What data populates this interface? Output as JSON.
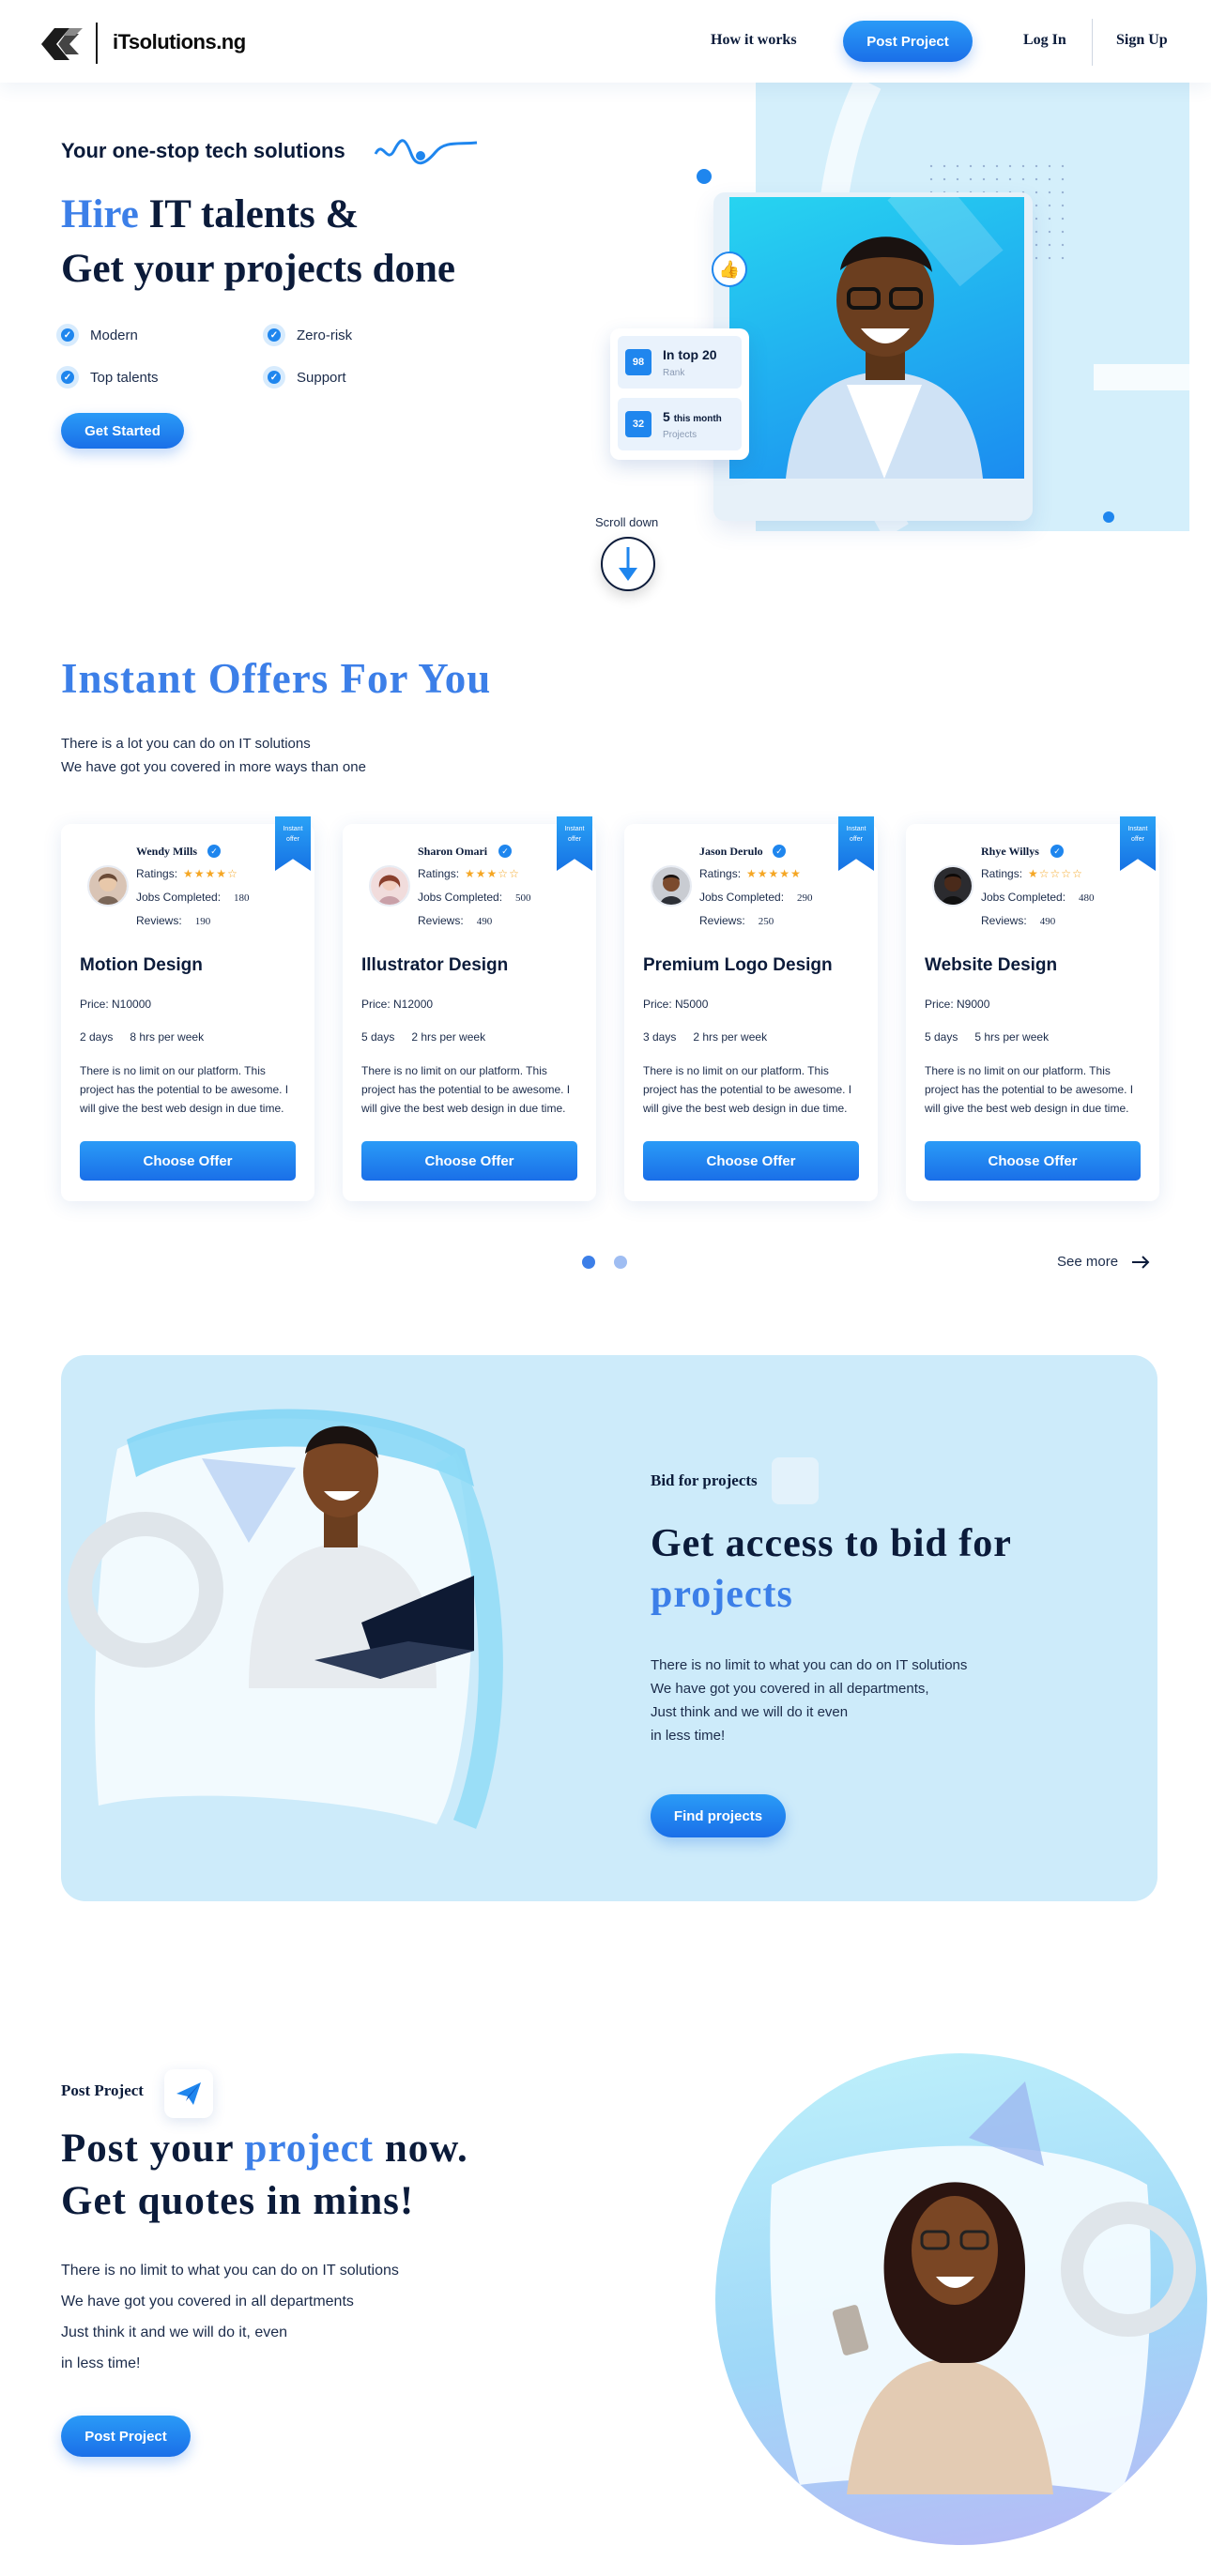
{
  "header": {
    "logo_text": "iTsolutions.ng",
    "nav": {
      "how_it_works": "How it works",
      "post_project": "Post Project",
      "login": "Log In",
      "signup": "Sign Up"
    }
  },
  "hero": {
    "tagline": "Your one-stop tech solutions",
    "title_accent": "Hire",
    "title_rest": " IT talents &",
    "title_line2": "Get your projects done",
    "features": [
      "Modern",
      "Zero-risk",
      "Top talents",
      "Support"
    ],
    "cta": "Get Started",
    "stat1": {
      "num": "98",
      "title": "In top 20",
      "sub": "Rank"
    },
    "stat2": {
      "num": "32",
      "title": "5",
      "title_small": "this month",
      "sub": "Projects"
    },
    "scroll": "Scroll down"
  },
  "offers": {
    "title": "Instant Offers For You",
    "sub1": "There is a lot you can do on IT solutions",
    "sub2": "We have got you covered in more ways than one",
    "ribbon_line1": "Instant",
    "ribbon_line2": "offer",
    "label_ratings": "Ratings:",
    "label_jobs": "Jobs Completed:",
    "label_reviews": "Reviews:",
    "desc": "There is no limit on our platform. This project has the potential to be awesome. I will give the best web design in due time.",
    "button": "Choose Offer",
    "cards": [
      {
        "name": "Wendy Mills",
        "stars": "★★★★☆",
        "jobs": "180",
        "reviews": "190",
        "title": "Motion Design",
        "price": "Price: N10000",
        "days": "2 days",
        "hours": "8 hrs per week"
      },
      {
        "name": "Sharon Omari",
        "stars": "★★★☆☆",
        "jobs": "500",
        "reviews": "490",
        "title": "Illustrator Design",
        "price": "Price: N12000",
        "days": "5 days",
        "hours": "2 hrs per week"
      },
      {
        "name": "Jason Derulo",
        "stars": "★★★★★",
        "jobs": "290",
        "reviews": "250",
        "title": "Premium Logo Design",
        "price": "Price: N5000",
        "days": "3 days",
        "hours": "2 hrs per week"
      },
      {
        "name": "Rhye Willys",
        "stars": "★☆☆☆☆",
        "jobs": "480",
        "reviews": "490",
        "title": "Website Design",
        "price": "Price: N9000",
        "days": "5 days",
        "hours": "5 hrs per week"
      }
    ],
    "see_more": "See more"
  },
  "bid": {
    "eyebrow": "Bid for projects",
    "title_line1": "Get access to bid for",
    "title_accent": "projects",
    "text": [
      "There is no limit to what you can do on IT solutions",
      "We have got you covered in all departments,",
      "Just think and we will do it even",
      "in less time!"
    ],
    "cta": "Find projects"
  },
  "post": {
    "eyebrow": "Post Project",
    "title_a": "Post your ",
    "title_accent": "project",
    "title_b": " now.",
    "title_line2": "Get quotes in mins!",
    "text": [
      "There is no limit to what you can do on IT solutions",
      "We have got you covered in all departments",
      "Just think it and we will do it, even",
      "in less time!"
    ],
    "cta": "Post Project"
  },
  "colors": {
    "accent": "#3c7fe8",
    "button": "#1a6fe8",
    "light_bg": "#cdebfa",
    "star": "#f5a623"
  }
}
